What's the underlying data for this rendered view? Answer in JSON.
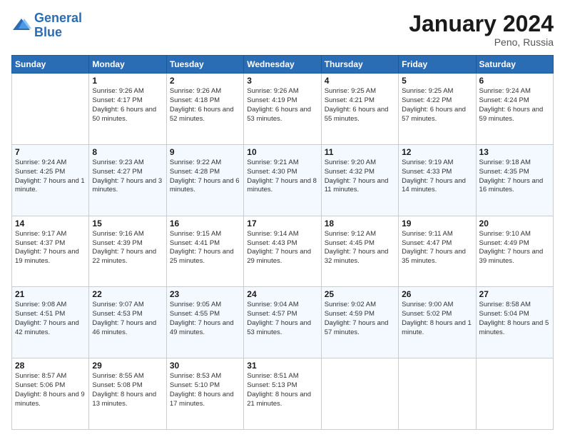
{
  "header": {
    "logo_line1": "General",
    "logo_line2": "Blue",
    "month_title": "January 2024",
    "location": "Peno, Russia"
  },
  "weekdays": [
    "Sunday",
    "Monday",
    "Tuesday",
    "Wednesday",
    "Thursday",
    "Friday",
    "Saturday"
  ],
  "weeks": [
    [
      {
        "day": "",
        "sunrise": "",
        "sunset": "",
        "daylight": ""
      },
      {
        "day": "1",
        "sunrise": "Sunrise: 9:26 AM",
        "sunset": "Sunset: 4:17 PM",
        "daylight": "Daylight: 6 hours and 50 minutes."
      },
      {
        "day": "2",
        "sunrise": "Sunrise: 9:26 AM",
        "sunset": "Sunset: 4:18 PM",
        "daylight": "Daylight: 6 hours and 52 minutes."
      },
      {
        "day": "3",
        "sunrise": "Sunrise: 9:26 AM",
        "sunset": "Sunset: 4:19 PM",
        "daylight": "Daylight: 6 hours and 53 minutes."
      },
      {
        "day": "4",
        "sunrise": "Sunrise: 9:25 AM",
        "sunset": "Sunset: 4:21 PM",
        "daylight": "Daylight: 6 hours and 55 minutes."
      },
      {
        "day": "5",
        "sunrise": "Sunrise: 9:25 AM",
        "sunset": "Sunset: 4:22 PM",
        "daylight": "Daylight: 6 hours and 57 minutes."
      },
      {
        "day": "6",
        "sunrise": "Sunrise: 9:24 AM",
        "sunset": "Sunset: 4:24 PM",
        "daylight": "Daylight: 6 hours and 59 minutes."
      }
    ],
    [
      {
        "day": "7",
        "sunrise": "Sunrise: 9:24 AM",
        "sunset": "Sunset: 4:25 PM",
        "daylight": "Daylight: 7 hours and 1 minute."
      },
      {
        "day": "8",
        "sunrise": "Sunrise: 9:23 AM",
        "sunset": "Sunset: 4:27 PM",
        "daylight": "Daylight: 7 hours and 3 minutes."
      },
      {
        "day": "9",
        "sunrise": "Sunrise: 9:22 AM",
        "sunset": "Sunset: 4:28 PM",
        "daylight": "Daylight: 7 hours and 6 minutes."
      },
      {
        "day": "10",
        "sunrise": "Sunrise: 9:21 AM",
        "sunset": "Sunset: 4:30 PM",
        "daylight": "Daylight: 7 hours and 8 minutes."
      },
      {
        "day": "11",
        "sunrise": "Sunrise: 9:20 AM",
        "sunset": "Sunset: 4:32 PM",
        "daylight": "Daylight: 7 hours and 11 minutes."
      },
      {
        "day": "12",
        "sunrise": "Sunrise: 9:19 AM",
        "sunset": "Sunset: 4:33 PM",
        "daylight": "Daylight: 7 hours and 14 minutes."
      },
      {
        "day": "13",
        "sunrise": "Sunrise: 9:18 AM",
        "sunset": "Sunset: 4:35 PM",
        "daylight": "Daylight: 7 hours and 16 minutes."
      }
    ],
    [
      {
        "day": "14",
        "sunrise": "Sunrise: 9:17 AM",
        "sunset": "Sunset: 4:37 PM",
        "daylight": "Daylight: 7 hours and 19 minutes."
      },
      {
        "day": "15",
        "sunrise": "Sunrise: 9:16 AM",
        "sunset": "Sunset: 4:39 PM",
        "daylight": "Daylight: 7 hours and 22 minutes."
      },
      {
        "day": "16",
        "sunrise": "Sunrise: 9:15 AM",
        "sunset": "Sunset: 4:41 PM",
        "daylight": "Daylight: 7 hours and 25 minutes."
      },
      {
        "day": "17",
        "sunrise": "Sunrise: 9:14 AM",
        "sunset": "Sunset: 4:43 PM",
        "daylight": "Daylight: 7 hours and 29 minutes."
      },
      {
        "day": "18",
        "sunrise": "Sunrise: 9:12 AM",
        "sunset": "Sunset: 4:45 PM",
        "daylight": "Daylight: 7 hours and 32 minutes."
      },
      {
        "day": "19",
        "sunrise": "Sunrise: 9:11 AM",
        "sunset": "Sunset: 4:47 PM",
        "daylight": "Daylight: 7 hours and 35 minutes."
      },
      {
        "day": "20",
        "sunrise": "Sunrise: 9:10 AM",
        "sunset": "Sunset: 4:49 PM",
        "daylight": "Daylight: 7 hours and 39 minutes."
      }
    ],
    [
      {
        "day": "21",
        "sunrise": "Sunrise: 9:08 AM",
        "sunset": "Sunset: 4:51 PM",
        "daylight": "Daylight: 7 hours and 42 minutes."
      },
      {
        "day": "22",
        "sunrise": "Sunrise: 9:07 AM",
        "sunset": "Sunset: 4:53 PM",
        "daylight": "Daylight: 7 hours and 46 minutes."
      },
      {
        "day": "23",
        "sunrise": "Sunrise: 9:05 AM",
        "sunset": "Sunset: 4:55 PM",
        "daylight": "Daylight: 7 hours and 49 minutes."
      },
      {
        "day": "24",
        "sunrise": "Sunrise: 9:04 AM",
        "sunset": "Sunset: 4:57 PM",
        "daylight": "Daylight: 7 hours and 53 minutes."
      },
      {
        "day": "25",
        "sunrise": "Sunrise: 9:02 AM",
        "sunset": "Sunset: 4:59 PM",
        "daylight": "Daylight: 7 hours and 57 minutes."
      },
      {
        "day": "26",
        "sunrise": "Sunrise: 9:00 AM",
        "sunset": "Sunset: 5:02 PM",
        "daylight": "Daylight: 8 hours and 1 minute."
      },
      {
        "day": "27",
        "sunrise": "Sunrise: 8:58 AM",
        "sunset": "Sunset: 5:04 PM",
        "daylight": "Daylight: 8 hours and 5 minutes."
      }
    ],
    [
      {
        "day": "28",
        "sunrise": "Sunrise: 8:57 AM",
        "sunset": "Sunset: 5:06 PM",
        "daylight": "Daylight: 8 hours and 9 minutes."
      },
      {
        "day": "29",
        "sunrise": "Sunrise: 8:55 AM",
        "sunset": "Sunset: 5:08 PM",
        "daylight": "Daylight: 8 hours and 13 minutes."
      },
      {
        "day": "30",
        "sunrise": "Sunrise: 8:53 AM",
        "sunset": "Sunset: 5:10 PM",
        "daylight": "Daylight: 8 hours and 17 minutes."
      },
      {
        "day": "31",
        "sunrise": "Sunrise: 8:51 AM",
        "sunset": "Sunset: 5:13 PM",
        "daylight": "Daylight: 8 hours and 21 minutes."
      },
      {
        "day": "",
        "sunrise": "",
        "sunset": "",
        "daylight": ""
      },
      {
        "day": "",
        "sunrise": "",
        "sunset": "",
        "daylight": ""
      },
      {
        "day": "",
        "sunrise": "",
        "sunset": "",
        "daylight": ""
      }
    ]
  ]
}
